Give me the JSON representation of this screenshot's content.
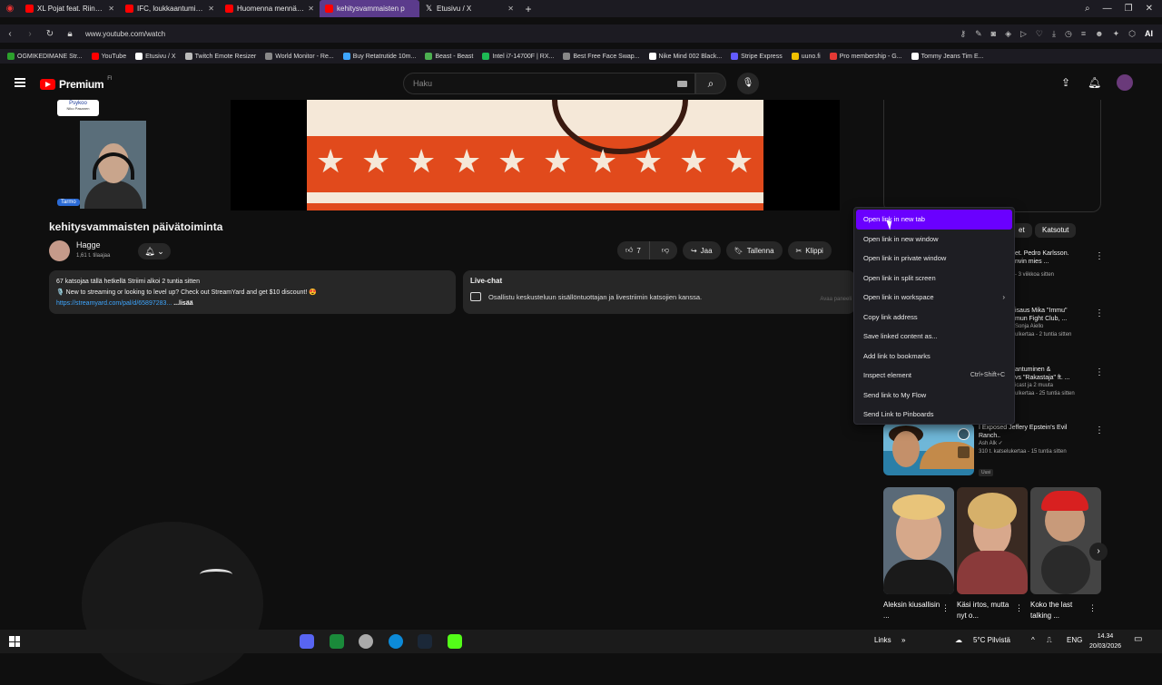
{
  "browser": {
    "tabs": [
      {
        "label": "XL Pojat feat. Riina ja Joni",
        "icon": "youtube-icon"
      },
      {
        "label": "IFC, loukkaantuminen &",
        "icon": "youtube-icon"
      },
      {
        "label": "Huomenna mennään! - Y",
        "icon": "youtube-icon"
      },
      {
        "label": "kehitysvammaisten p",
        "icon": "audio-icon",
        "active": true
      },
      {
        "label": "Etusivu / X",
        "icon": "x-icon"
      }
    ],
    "url": "www.youtube.com/watch",
    "bookmarks": [
      {
        "label": "OGMIKEDIMANE Str...",
        "color": "#2ca02c"
      },
      {
        "label": "YouTube",
        "color": "#ff0000"
      },
      {
        "label": "Etusivu / X",
        "color": "#ffffff"
      },
      {
        "label": "Twitch Emote Resizer",
        "color": "#bbbbbb"
      },
      {
        "label": "World Monitor - Re...",
        "color": "#888888"
      },
      {
        "label": "Buy Retatrutide 10m...",
        "color": "#3ea6ff"
      },
      {
        "label": "Beast - Beast",
        "color": "#4caf50"
      },
      {
        "label": "Intel i7-14700F | RX...",
        "color": "#1db954"
      },
      {
        "label": "Best Free Face Swap...",
        "color": "#888888"
      },
      {
        "label": "Nike Mind 002 Black...",
        "color": "#ffffff"
      },
      {
        "label": "Stripe Express",
        "color": "#635bff"
      },
      {
        "label": "uuno.fi",
        "color": "#f0c000"
      },
      {
        "label": "Pro membership - G...",
        "color": "#e53935"
      },
      {
        "label": "Tommy Jeans Tim E...",
        "color": "#ffffff"
      }
    ],
    "ai_label": "AI"
  },
  "youtube": {
    "logo_text": "Premium",
    "logo_region": "FI",
    "search_placeholder": "Haku"
  },
  "video": {
    "overlay_badge": "Psykoo",
    "overlay_badge_sub": "Niko Pasanen",
    "streamer_tag": "Tarmo",
    "title": "kehitysvammaisten päivätoiminta",
    "channel_name": "Hagge",
    "channel_subs": "1,61 t. tilaajaa",
    "likes": "7",
    "share_label": "Jaa",
    "save_label": "Tallenna",
    "clip_label": "Klippi"
  },
  "description": {
    "line1": "67 katsojaa tällä hetkellä  Striimi alkoi 2 tuntia sitten",
    "line2": "🎙️ New to streaming or looking to level up? Check out StreamYard and get $10 discount! 😍",
    "link": "https://streamyard.com/pal/d/65897283...",
    "more": "...lisää"
  },
  "livechat": {
    "label": "Live-chat",
    "text": "Osallistu keskusteluun sisällöntuottajan ja livestriimin katsojien kanssa.",
    "hint": "Avaa paneeli"
  },
  "chips": [
    "et",
    "Katsotut"
  ],
  "recommendations": [
    {
      "title_l1": "et. Pedro Karlsson.",
      "title_l2": "nvin mies ...",
      "meta": "  - 3 viikkoa sitten"
    },
    {
      "title_l1": "isaus Mika \"Immu\"",
      "title_l2": "mun Fight Club, ...",
      "meta": "Sonja Aiello",
      "meta2": "ulkertaa - 2 tuntia sitten"
    },
    {
      "title_l1": "antuminen &",
      "title_l2": "vs \"Rakastaja\" ft. ...",
      "meta": "icast ja 2 muuta",
      "meta2": "ulkertaa - 25 tuntia sitten"
    },
    {
      "title_l1": "I Exposed Jeffery Epstein's Evil",
      "title_l2": "Ranch..",
      "meta": "Ash Alk ✓",
      "meta2": "310 t. katselukertaa - 15 tuntia sitten",
      "badge": "Uusi"
    }
  ],
  "shorts": [
    {
      "title": "Aleksin kiusallisin ..."
    },
    {
      "title": "Käsi irtos, mutta nyt o..."
    },
    {
      "title": "Koko the last talking ..."
    }
  ],
  "context_menu": {
    "items": [
      {
        "label": "Open link in new tab",
        "highlighted": true
      },
      {
        "label": "Open link in new window"
      },
      {
        "label": "Open link in private window"
      },
      {
        "label": "Open link in split screen"
      },
      {
        "label": "Open link in workspace",
        "submenu": true
      },
      {
        "label": "Copy link address"
      },
      {
        "label": "Save linked content as..."
      },
      {
        "label": "Add link to bookmarks"
      },
      {
        "label": "Inspect element",
        "shortcut": "Ctrl+Shift+C"
      },
      {
        "label": "Send link to My Flow"
      },
      {
        "label": "Send Link to Pinboards"
      }
    ]
  },
  "taskbar": {
    "links_label": "Links",
    "weather": "5°C Pilvistä",
    "language": "ENG",
    "time": "14.34",
    "date": "20/03/2026"
  },
  "colors": {
    "accent": "#6a00ff",
    "youtube_red": "#ff0000",
    "link": "#3ea6ff"
  }
}
